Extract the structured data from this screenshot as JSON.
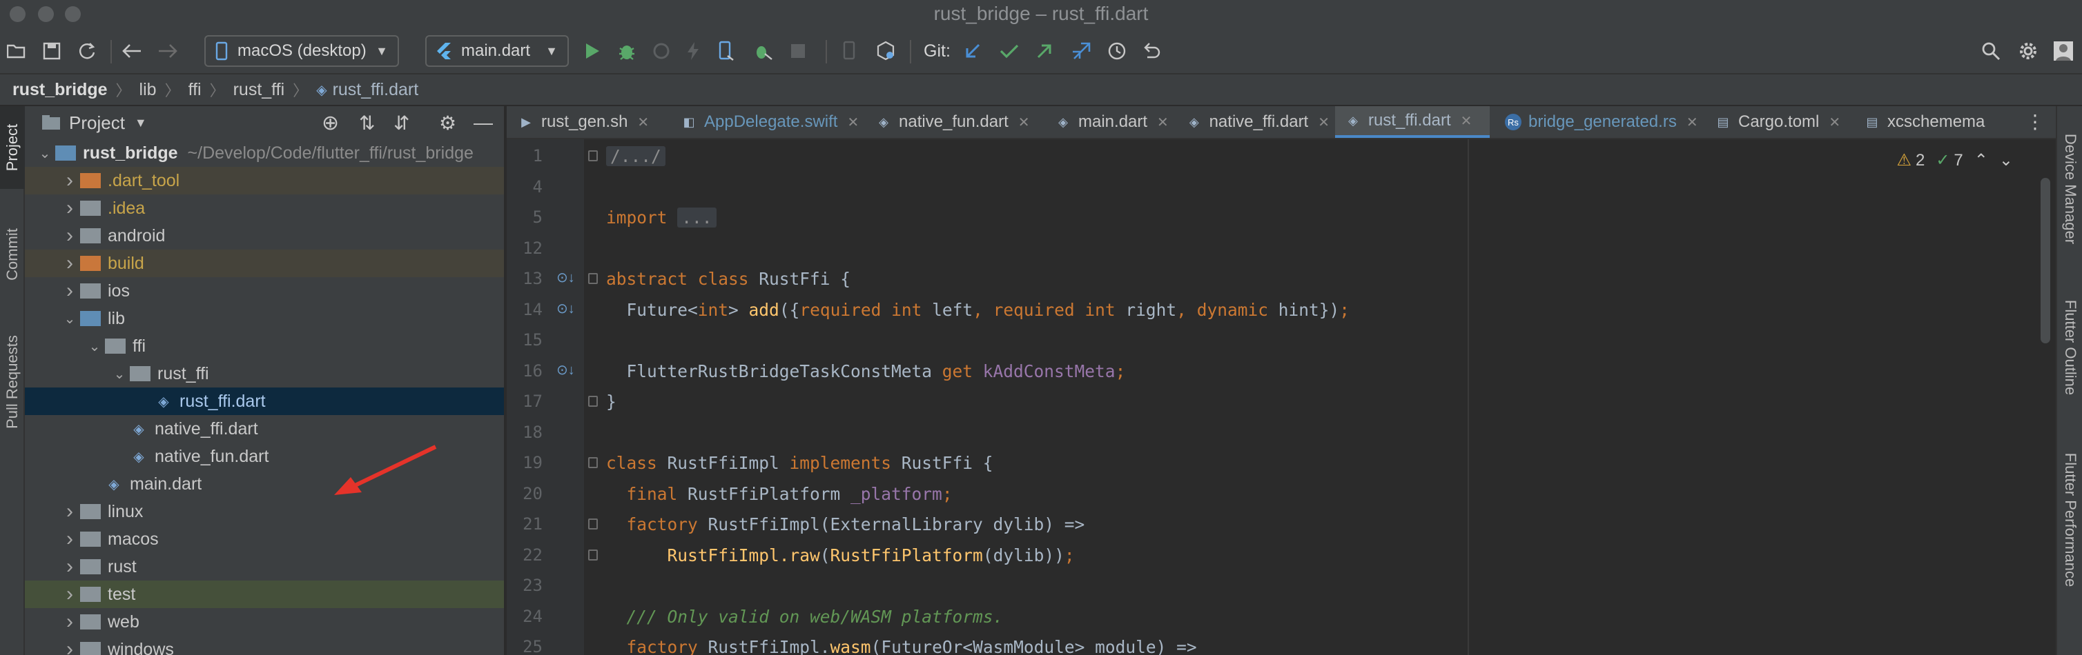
{
  "window": {
    "title": "rust_bridge – rust_ffi.dart"
  },
  "toolbar": {
    "device": "macOS (desktop)",
    "run_config": "main.dart",
    "git_label": "Git:"
  },
  "breadcrumb": [
    "rust_bridge",
    "lib",
    "ffi",
    "rust_ffi",
    "rust_ffi.dart"
  ],
  "left_strip": [
    "Project",
    "Commit",
    "Pull Requests"
  ],
  "right_strip": [
    "Device Manager",
    "Flutter Outline",
    "Flutter Performance"
  ],
  "project": {
    "title": "Project",
    "tree": [
      {
        "name": "rust_bridge",
        "path": "~/Develop/Code/flutter_ffi/rust_bridge",
        "depth": 0,
        "chev": "open",
        "kind": "module",
        "style": "root"
      },
      {
        "name": ".dart_tool",
        "depth": 1,
        "chev": "closed",
        "kind": "folder-orange",
        "style": "excluded"
      },
      {
        "name": ".idea",
        "depth": 1,
        "chev": "closed",
        "kind": "folder-gray",
        "style": "ignored"
      },
      {
        "name": "android",
        "depth": 1,
        "chev": "closed",
        "kind": "folder-gray",
        "style": ""
      },
      {
        "name": "build",
        "depth": 1,
        "chev": "closed",
        "kind": "folder-orange",
        "style": "excluded"
      },
      {
        "name": "ios",
        "depth": 1,
        "chev": "closed",
        "kind": "folder-gray",
        "style": ""
      },
      {
        "name": "lib",
        "depth": 1,
        "chev": "open",
        "kind": "folder-src",
        "style": ""
      },
      {
        "name": "ffi",
        "depth": 2,
        "chev": "open",
        "kind": "folder-gray",
        "style": ""
      },
      {
        "name": "rust_ffi",
        "depth": 3,
        "chev": "open",
        "kind": "folder-gray",
        "style": ""
      },
      {
        "name": "rust_ffi.dart",
        "depth": 4,
        "chev": "none",
        "kind": "dart",
        "style": "selected"
      },
      {
        "name": "native_ffi.dart",
        "depth": 3,
        "chev": "none",
        "kind": "dart",
        "style": ""
      },
      {
        "name": "native_fun.dart",
        "depth": 3,
        "chev": "none",
        "kind": "dart",
        "style": ""
      },
      {
        "name": "main.dart",
        "depth": 2,
        "chev": "none",
        "kind": "dart",
        "style": ""
      },
      {
        "name": "linux",
        "depth": 1,
        "chev": "closed",
        "kind": "folder-gray",
        "style": ""
      },
      {
        "name": "macos",
        "depth": 1,
        "chev": "closed",
        "kind": "folder-gray",
        "style": ""
      },
      {
        "name": "rust",
        "depth": 1,
        "chev": "closed",
        "kind": "folder-gray",
        "style": ""
      },
      {
        "name": "test",
        "depth": 1,
        "chev": "closed",
        "kind": "folder-gray",
        "style": "test"
      },
      {
        "name": "web",
        "depth": 1,
        "chev": "closed",
        "kind": "folder-gray",
        "style": ""
      },
      {
        "name": "windows",
        "depth": 1,
        "chev": "closed",
        "kind": "folder-gray",
        "style": ""
      }
    ]
  },
  "tabs": [
    {
      "label": "rust_gen.sh",
      "icon": "shell-icon",
      "state": ""
    },
    {
      "label": "AppDelegate.swift",
      "icon": "swift-icon",
      "state": "modified"
    },
    {
      "label": "native_fun.dart",
      "icon": "dart-icon",
      "state": ""
    },
    {
      "label": "main.dart",
      "icon": "dart-icon",
      "state": ""
    },
    {
      "label": "native_ffi.dart",
      "icon": "dart-icon",
      "state": ""
    },
    {
      "label": "rust_ffi.dart",
      "icon": "dart-icon",
      "state": "active"
    },
    {
      "label": "bridge_generated.rs",
      "icon": "rust-icon",
      "state": "modified"
    },
    {
      "label": "Cargo.toml",
      "icon": "toml-icon",
      "state": ""
    },
    {
      "label": "xcschemema",
      "icon": "xml-icon",
      "state": ""
    }
  ],
  "inspection": {
    "warnings": "2",
    "ok": "7"
  },
  "code": [
    {
      "n": "1",
      "html": "<span class=\"fold-text\">/.../</span>"
    },
    {
      "n": "4",
      "html": ""
    },
    {
      "n": "5",
      "html": "<span class=\"kw\">import</span> <span class=\"fold-text\">...</span>"
    },
    {
      "n": "12",
      "html": ""
    },
    {
      "n": "13",
      "html": "<span class=\"kw\">abstract class</span> RustFfi {"
    },
    {
      "n": "14",
      "html": "  Future&lt;<span class=\"kw\">int</span>&gt; <span class=\"fn\">add</span>({<span class=\"kw\">required int</span> left<span class=\"pn\">,</span> <span class=\"kw\">required int</span> right<span class=\"pn\">,</span> <span class=\"kw\">dynamic</span> hint})<span class=\"pn\">;</span>"
    },
    {
      "n": "15",
      "html": ""
    },
    {
      "n": "16",
      "html": "  FlutterRustBridgeTaskConstMeta <span class=\"kw\">get</span> <span class=\"it\" style=\"font-style:normal\">kAddConstMeta</span><span class=\"pn\">;</span>"
    },
    {
      "n": "17",
      "html": "}"
    },
    {
      "n": "18",
      "html": ""
    },
    {
      "n": "19",
      "html": "<span class=\"kw\">class</span> RustFfiImpl <span class=\"kw\">implements</span> RustFfi {"
    },
    {
      "n": "20",
      "html": "  <span class=\"kw\">final</span> RustFfiPlatform <span class=\"it\" style=\"font-style:normal\">_platform</span><span class=\"pn\">;</span>"
    },
    {
      "n": "21",
      "html": "  <span class=\"kw\">factory</span> RustFfiImpl(ExternalLibrary dylib) =&gt;"
    },
    {
      "n": "22",
      "html": "      <span class=\"fn\">RustFfiImpl.raw</span>(<span class=\"fn\">RustFfiPlatform</span>(dylib))<span class=\"pn\">;</span>"
    },
    {
      "n": "23",
      "html": ""
    },
    {
      "n": "24",
      "html": "  <span class=\"cm\">/// Only valid on web/WASM platforms.</span>"
    },
    {
      "n": "25",
      "html": "  <span class=\"kw\">factory</span> RustFfiImpl.<span class=\"fn\">wasm</span>(FutureOr&lt;WasmModule&gt; module) =&gt;"
    }
  ]
}
